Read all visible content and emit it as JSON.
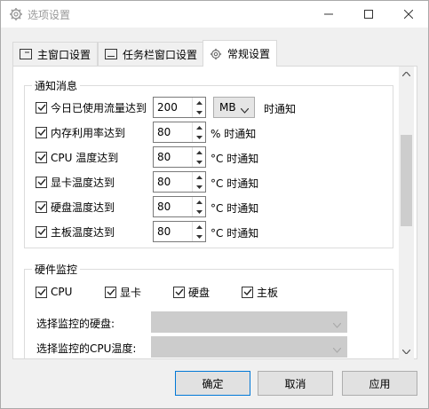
{
  "window": {
    "title": "选项设置"
  },
  "tabs": [
    {
      "label": "主窗口设置",
      "icon": "window-icon"
    },
    {
      "label": "任务栏窗口设置",
      "icon": "taskbar-icon"
    },
    {
      "label": "常规设置",
      "icon": "gear-icon"
    }
  ],
  "notify": {
    "title": "通知消息",
    "rows": [
      {
        "label": "今日已使用流量达到",
        "value": "200",
        "unit_select": "MB",
        "unit": "时通知",
        "checked": true
      },
      {
        "label": "内存利用率达到",
        "value": "80",
        "unit": "% 时通知",
        "checked": true
      },
      {
        "label": "CPU 温度达到",
        "value": "80",
        "unit": "°C 时通知",
        "checked": true
      },
      {
        "label": "显卡温度达到",
        "value": "80",
        "unit": "°C 时通知",
        "checked": true
      },
      {
        "label": "硬盘温度达到",
        "value": "80",
        "unit": "°C 时通知",
        "checked": true
      },
      {
        "label": "主板温度达到",
        "value": "80",
        "unit": "°C 时通知",
        "checked": true
      }
    ]
  },
  "hardware": {
    "title": "硬件监控",
    "checks": [
      {
        "label": "CPU",
        "checked": true
      },
      {
        "label": "显卡",
        "checked": true
      },
      {
        "label": "硬盘",
        "checked": true
      },
      {
        "label": "主板",
        "checked": true
      }
    ],
    "disk_label": "选择监控的硬盘:",
    "disk_value": "",
    "cpu_label": "选择监控的CPU温度:",
    "cpu_value": ""
  },
  "buttons": {
    "ok": "确定",
    "cancel": "取消",
    "apply": "应用"
  }
}
